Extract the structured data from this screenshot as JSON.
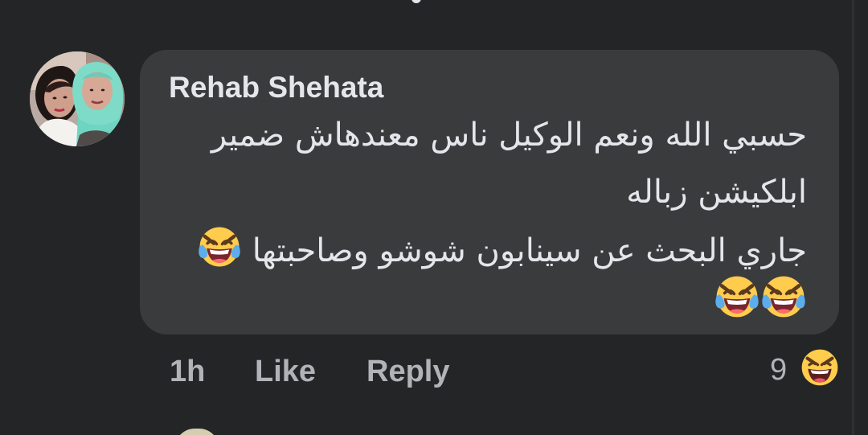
{
  "comment": {
    "author": "Rehab Shehata",
    "lines": [
      "حسبي الله ونعم الوكيل ناس معندهاش ضمير",
      "ابلكيشن زباله",
      "جاري البحث عن سينابون شوشو وصاحبتها"
    ],
    "inline_emoji": "face-with-tears-of-joy-icon",
    "trailing_emojis": [
      "face-with-tears-of-joy-icon",
      "face-with-tears-of-joy-icon"
    ]
  },
  "actions": {
    "time": "1h",
    "like_label": "Like",
    "reply_label": "Reply",
    "reaction_count": "9",
    "reaction_icon": "haha-reaction-icon"
  },
  "colors": {
    "background": "#242526",
    "bubble": "#3a3b3c",
    "text": "#e4e6eb",
    "secondary_text": "#b0b3b8",
    "emoji_yellow": "#ffcc4d"
  }
}
